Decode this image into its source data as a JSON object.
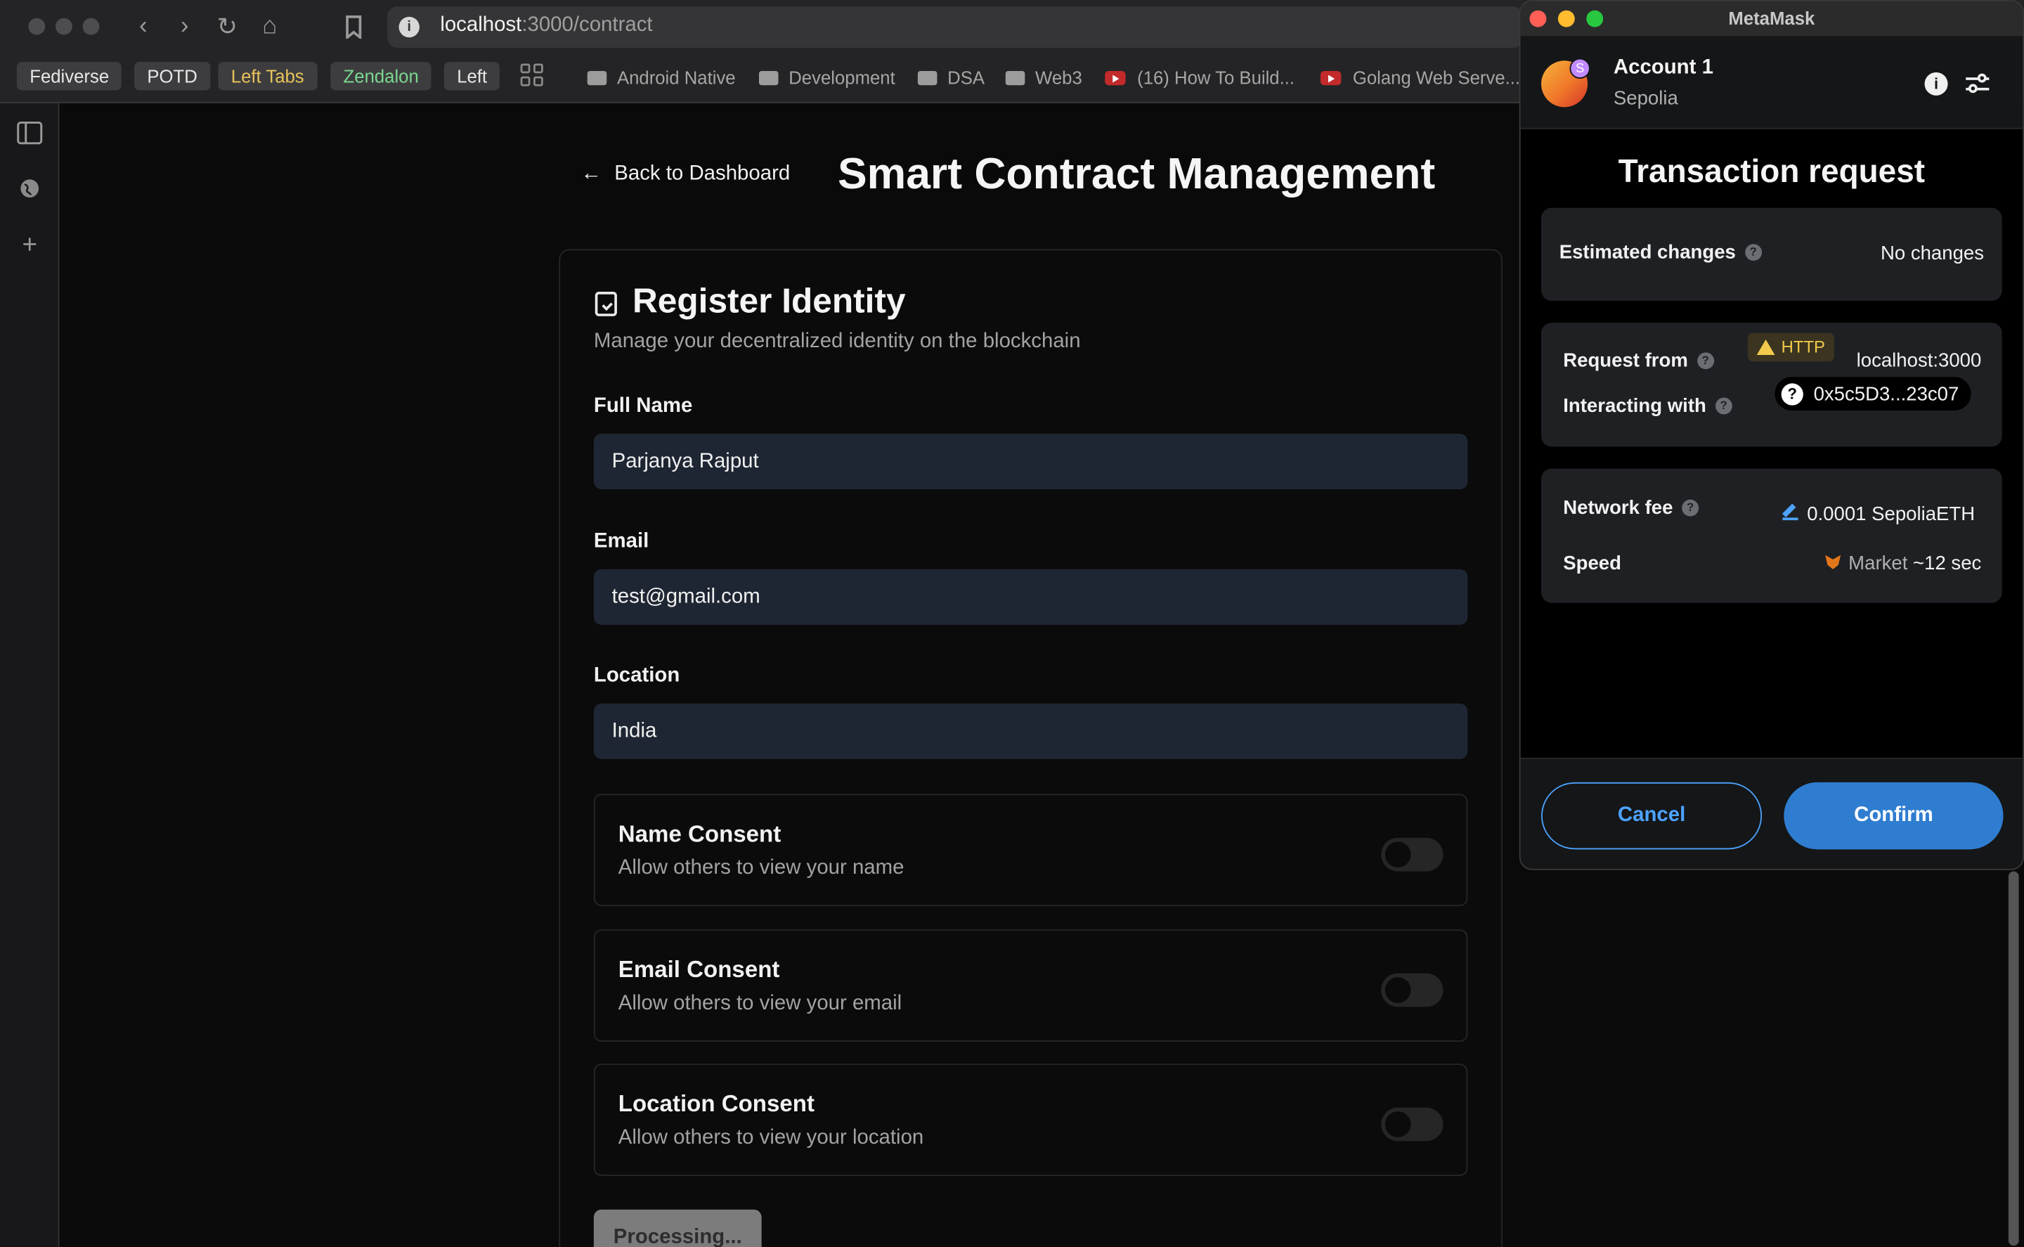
{
  "browser": {
    "url_host": "localhost",
    "url_path": ":3000/contract",
    "bookmarks_tabs": [
      "Fediverse",
      "POTD",
      "Left Tabs",
      "Zendalon",
      "Left"
    ],
    "bookmark_folders": [
      "Android Native",
      "Development",
      "DSA",
      "Web3"
    ],
    "bookmark_videos": [
      "(16) How To Build...",
      "Golang Web Serve..."
    ],
    "colors": {
      "left_tabs": "#e8c35a",
      "zendalon": "#7bd88f"
    }
  },
  "page": {
    "back_label": "Back to Dashboard",
    "title": "Smart Contract Management",
    "card": {
      "title": "Register Identity",
      "subtitle": "Manage your decentralized identity on the blockchain",
      "fields": [
        {
          "label": "Full Name",
          "value": "Parjanya Rajput"
        },
        {
          "label": "Email",
          "value": "test@gmail.com"
        },
        {
          "label": "Location",
          "value": "India"
        }
      ],
      "consents": [
        {
          "title": "Name Consent",
          "desc": "Allow others to view your name",
          "enabled": false
        },
        {
          "title": "Email Consent",
          "desc": "Allow others to view your email",
          "enabled": false
        },
        {
          "title": "Location Consent",
          "desc": "Allow others to view your location",
          "enabled": false
        }
      ],
      "submit_label": "Processing..."
    }
  },
  "metamask": {
    "window_title": "MetaMask",
    "account_name": "Account 1",
    "network": "Sepolia",
    "network_badge": "S",
    "heading": "Transaction request",
    "estimated_changes_label": "Estimated changes",
    "estimated_changes_value": "No changes",
    "request_from_label": "Request from",
    "http_badge": "HTTP",
    "request_from_value": "localhost:3000",
    "interacting_with_label": "Interacting with",
    "interacting_with_value": "0x5c5D3...23c07",
    "network_fee_label": "Network fee",
    "network_fee_value": "0.0001 SepoliaETH",
    "speed_label": "Speed",
    "speed_value": "Market",
    "speed_time": "~12 sec",
    "cancel_label": "Cancel",
    "confirm_label": "Confirm",
    "accent_color": "#2f7dd1"
  }
}
